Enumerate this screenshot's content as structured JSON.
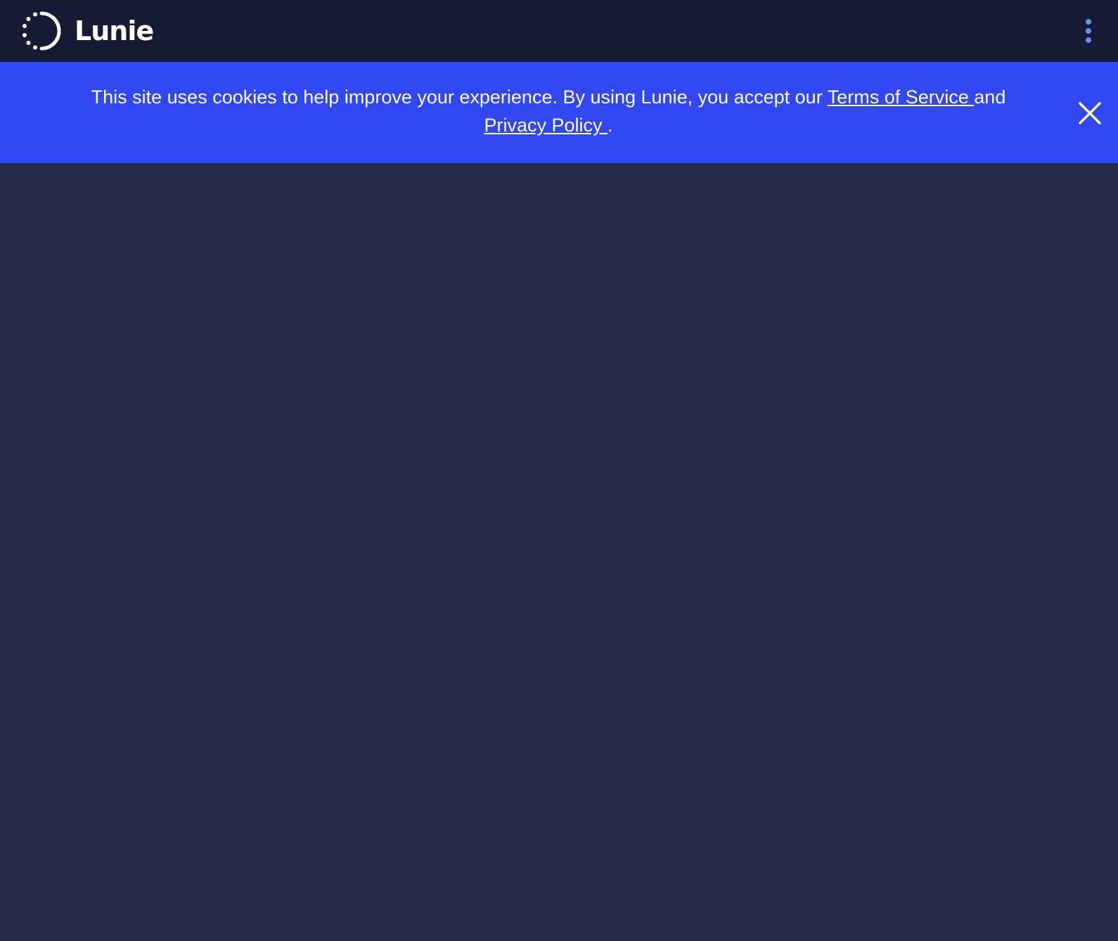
{
  "header": {
    "brand_name": "Lunie",
    "logo_icon": "lunie-logo-icon",
    "menu_icon": "vertical-dots-icon"
  },
  "cookie_banner": {
    "text_before": "This site uses cookies to help improve your experience. By using Lunie, you accept our ",
    "terms_link": "Terms of Service ",
    "text_middle": "and ",
    "privacy_link": "Privacy Policy ",
    "text_after": ".",
    "close_icon": "close-icon"
  },
  "colors": {
    "topbar_bg": "#161b33",
    "banner_bg": "#3247f4",
    "page_bg": "#262a49",
    "menu_dots": "#5e90ff",
    "text": "#ffffff"
  }
}
